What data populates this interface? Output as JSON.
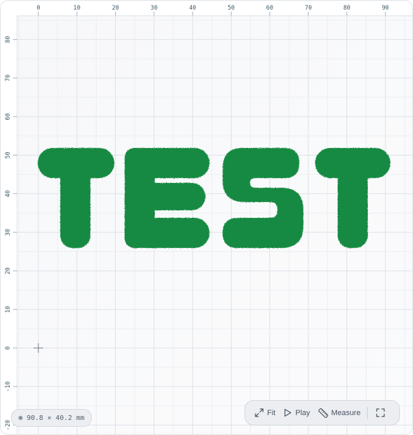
{
  "ruler": {
    "x_ticks": [
      "0",
      "10",
      "20",
      "30",
      "40",
      "50",
      "60",
      "70",
      "80",
      "90"
    ],
    "y_ticks": [
      "80",
      "70",
      "60",
      "50",
      "40",
      "30",
      "20",
      "10",
      "0",
      "-10",
      "-20"
    ]
  },
  "design": {
    "text": "TEST",
    "color": "#148a42",
    "dimensions": "90.8 × 40.2 mm"
  },
  "toolbar": {
    "fit_label": "Fit",
    "play_label": "Play",
    "measure_label": "Measure",
    "fullscreen_icon": "fullscreen-icon"
  }
}
